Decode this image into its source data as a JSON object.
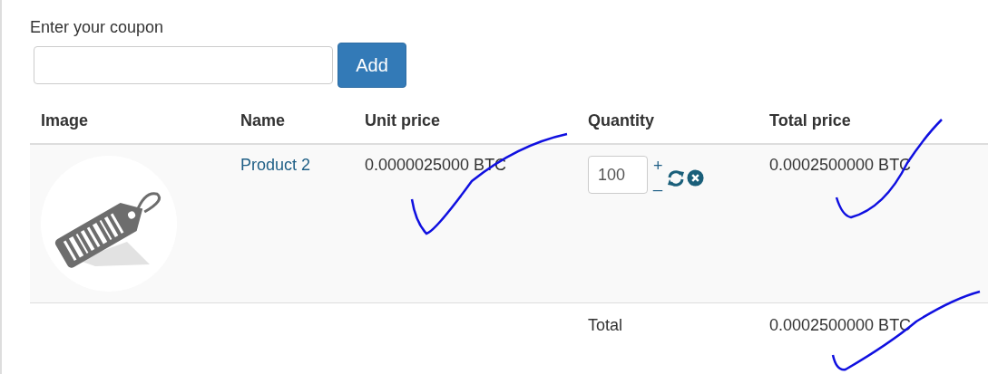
{
  "coupon": {
    "label": "Enter your coupon",
    "button": "Add"
  },
  "table": {
    "columns": [
      "Image",
      "Name",
      "Unit price",
      "Quantity",
      "Total price"
    ],
    "rows": [
      {
        "name": "Product 2",
        "unit_price": "0.0000025000 BTC",
        "quantity": "100",
        "increase": "+",
        "decrease": "_",
        "total_price": "0.0002500000 BTC"
      }
    ],
    "footer": {
      "label": "Total",
      "value": "0.0002500000 BTC"
    }
  }
}
